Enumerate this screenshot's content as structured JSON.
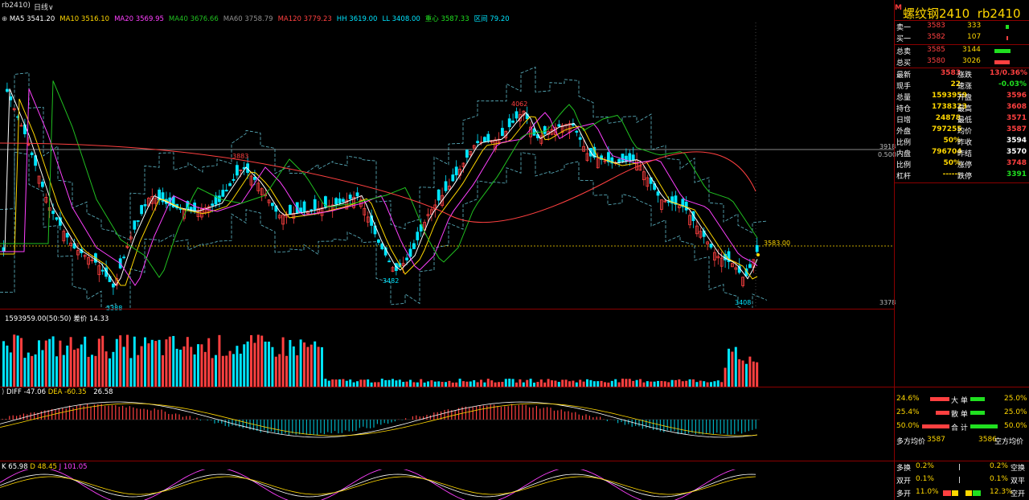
{
  "toolbar": {
    "symbol": "rb2410",
    "period": "日线"
  },
  "ma_line": [
    {
      "label": "MA5",
      "value": "3541.20",
      "color": "#ffffff"
    },
    {
      "label": "MA10",
      "value": "3516.10",
      "color": "#ffd700"
    },
    {
      "label": "MA20",
      "value": "3569.95",
      "color": "#ff40ff"
    },
    {
      "label": "MA40",
      "value": "3676.66",
      "color": "#20c020"
    },
    {
      "label": "MA60",
      "value": "3758.79",
      "color": "#909090"
    },
    {
      "label": "MA120",
      "value": "3779.23",
      "color": "#ff4040"
    },
    {
      "label": "HH",
      "value": "3619.00",
      "color": "#00e5ff"
    },
    {
      "label": "LL",
      "value": "3408.00",
      "color": "#00e5ff"
    },
    {
      "label": "重心",
      "value": "3587.33",
      "color": "#20e020"
    },
    {
      "label": "区间",
      "value": "79.20",
      "color": "#00e5ff"
    }
  ],
  "price_labels": {
    "high_mark": "4062",
    "mid_high": "3883",
    "low_mid": "3482",
    "low_left": "3388",
    "low_right": "3408",
    "current": "3583.00",
    "axis_top": "3918",
    "axis_top2": "0.500",
    "axis_bottom": "3378"
  },
  "vol_line": {
    "text": "1593959.00(50:50)",
    "diff_label": "差价",
    "diff": "14.33"
  },
  "macd_line": {
    "diff": "-47.06",
    "dea": "-60.35",
    "macd": "26.58"
  },
  "kdj_line": {
    "k": "65.98",
    "d": "48.45",
    "j": "101.05"
  },
  "panel": {
    "title": "螺纹钢2410",
    "code": "rb2410",
    "sell1": {
      "label": "卖一",
      "price": "3583",
      "vol": "333"
    },
    "buy1": {
      "label": "买一",
      "price": "3582",
      "vol": "107"
    },
    "total_sell": {
      "label": "总卖",
      "price": "3585",
      "vol": "3144"
    },
    "total_buy": {
      "label": "总买",
      "price": "3580",
      "vol": "3026"
    },
    "stats": [
      {
        "l1": "最新",
        "v1": "3583",
        "c1": "#ff4040",
        "l2": "涨跌",
        "v2": "13/0.36%",
        "c2": "#ff4040"
      },
      {
        "l1": "现手",
        "v1": "22",
        "c1": "#ffd700",
        "l2": "速涨",
        "v2": "-0.03%",
        "c2": "#20e020"
      },
      {
        "l1": "总量",
        "v1": "1593959",
        "c1": "#ffd700",
        "l2": "开盘",
        "v2": "3596",
        "c2": "#ff4040"
      },
      {
        "l1": "持仓",
        "v1": "1738323",
        "c1": "#ffd700",
        "l2": "最高",
        "v2": "3608",
        "c2": "#ff4040"
      },
      {
        "l1": "日增",
        "v1": "24878",
        "c1": "#ffd700",
        "l2": "最低",
        "v2": "3571",
        "c2": "#ff4040"
      },
      {
        "l1": "外盘",
        "v1": "797255",
        "c1": "#ffd700",
        "l2": "均价",
        "v2": "3587",
        "c2": "#ff4040"
      },
      {
        "l1": "比例",
        "v1": "50%",
        "c1": "#ffd700",
        "l2": "昨收",
        "v2": "3594",
        "c2": "#ffffff"
      },
      {
        "l1": "内盘",
        "v1": "796704",
        "c1": "#ffd700",
        "l2": "昨结",
        "v2": "3570",
        "c2": "#ffffff"
      },
      {
        "l1": "比例",
        "v1": "50%",
        "c1": "#ffd700",
        "l2": "涨停",
        "v2": "3748",
        "c2": "#ff4040"
      },
      {
        "l1": "杠杆",
        "v1": "------",
        "c1": "#ffd700",
        "l2": "跌停",
        "v2": "3391",
        "c2": "#20e020"
      }
    ],
    "flow": [
      {
        "left": "24.6%",
        "label": "大 单",
        "right": "25.0%"
      },
      {
        "left": "25.4%",
        "label": "散 单",
        "right": "25.0%"
      },
      {
        "left": "50.0%",
        "label": "合 计",
        "right": "50.0%"
      }
    ],
    "avg": {
      "long_label": "多方均价",
      "long": "3587",
      "short": "3586",
      "short_label": "空方均价"
    },
    "positions": [
      {
        "l": "多换",
        "lv": "0.2%",
        "rv": "0.2%",
        "r": "空换"
      },
      {
        "l": "双开",
        "lv": "0.1%",
        "rv": "0.1%",
        "r": "双平"
      },
      {
        "l": "多开",
        "lv": "11.0%",
        "rv": "12.3%",
        "r": "空开"
      }
    ]
  },
  "colors": {
    "up": "#ff4040",
    "down": "#00e5ff",
    "border": "#8b0000"
  }
}
